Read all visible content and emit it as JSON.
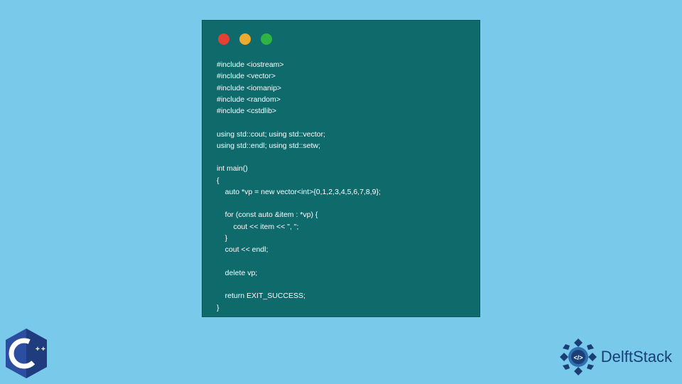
{
  "window": {
    "traffic_lights": [
      "red",
      "yellow",
      "green"
    ]
  },
  "code": {
    "lines": [
      "#include <iostream>",
      "#include <vector>",
      "#include <iomanip>",
      "#include <random>",
      "#include <cstdlib>",
      "",
      "using std::cout; using std::vector;",
      "using std::endl; using std::setw;",
      "",
      "int main()",
      "{",
      "    auto *vp = new vector<int>{0,1,2,3,4,5,6,7,8,9};",
      "",
      "    for (const auto &item : *vp) {",
      "        cout << item << \", \";",
      "    }",
      "    cout << endl;",
      "",
      "    delete vp;",
      "",
      "    return EXIT_SUCCESS;",
      "}"
    ]
  },
  "logos": {
    "cpp_label": "C++",
    "delftstack": "DelftStack"
  },
  "colors": {
    "page_bg": "#79c9eb",
    "window_bg": "#0e6a6b",
    "code_fg": "#ffffff",
    "cpp_blue": "#2b4ea0",
    "delft_blue": "#1b3f75"
  }
}
